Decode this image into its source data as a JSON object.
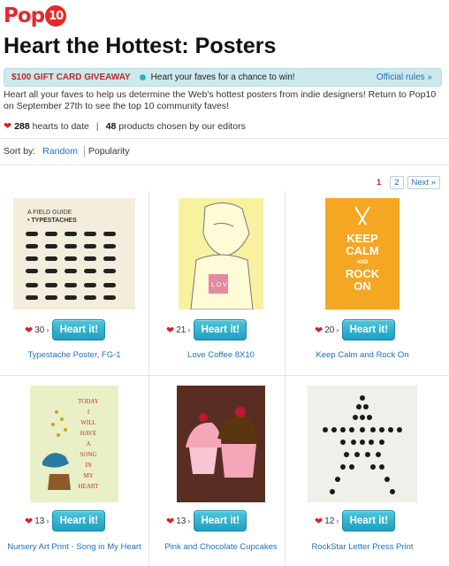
{
  "logo": {
    "text": "Pop",
    "number": "10"
  },
  "page_title": "Heart the Hottest: Posters",
  "banner": {
    "giveaway": "$100 GIFT CARD GIVEAWAY",
    "message": "Heart your faves for a chance to win!",
    "rules": "Official rules »"
  },
  "intro": "Heart all your faves to help us determine the Web's hottest posters from indie designers! Return to Pop10 on September 27th to see the top 10 community faves!",
  "stats": {
    "hearts_count": "288",
    "hearts_label": "hearts to date",
    "products_count": "48",
    "products_label": "products chosen by our editors"
  },
  "sort": {
    "label": "Sort by:",
    "options": [
      "Random",
      "Popularity"
    ],
    "selected": "Random"
  },
  "pagination": {
    "current": "1",
    "page2": "2",
    "next": "Next »"
  },
  "heart_button_label": "Heart it!",
  "products": [
    {
      "title": "Typestache Poster, FG-1",
      "hearts": "30",
      "thumb_text": "A FIELD GUIDE TYPESTACHES"
    },
    {
      "title": "Love Coffee 8X10",
      "hearts": "21",
      "thumb_text": "LOVE"
    },
    {
      "title": "Keep Calm and Rock On",
      "hearts": "20",
      "thumb_text": [
        "KEEP",
        "CALM",
        "AND",
        "ROCK",
        "ON"
      ]
    },
    {
      "title": "Nursery Art Print - Song in My Heart",
      "hearts": "13",
      "thumb_text": "TODAY I WILL HAVE A SONG IN MY HEART"
    },
    {
      "title": "Pink and Chocolate Cupcakes",
      "hearts": "13",
      "thumb_text": ""
    },
    {
      "title": "RockStar Letter Press Print",
      "hearts": "12",
      "thumb_text": ""
    }
  ],
  "colors": {
    "brand_red": "#e8272a",
    "button": "#1f9fbf",
    "link": "#1f6fbf",
    "keep_calm_bg": "#f5a623"
  }
}
